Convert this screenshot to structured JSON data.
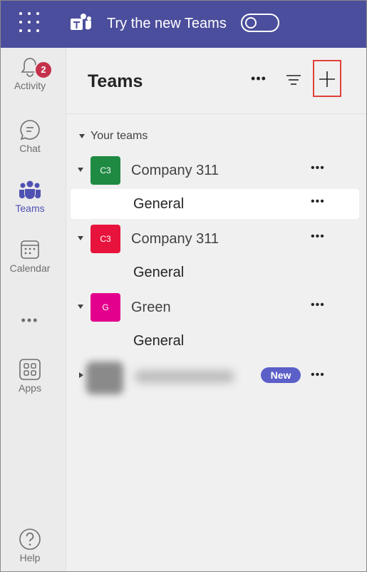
{
  "topbar": {
    "title": "Try the new Teams",
    "toggle_on": false,
    "bg_color": "#4b4e9c"
  },
  "rail": {
    "items": [
      {
        "label": "Activity",
        "icon": "bell-icon",
        "badge": "2"
      },
      {
        "label": "Chat",
        "icon": "chat-icon"
      },
      {
        "label": "Teams",
        "icon": "teams-icon",
        "active": true
      },
      {
        "label": "Calendar",
        "icon": "calendar-icon"
      },
      {
        "label": "Apps",
        "icon": "apps-icon"
      },
      {
        "label": "Help",
        "icon": "help-icon"
      }
    ],
    "more_label": "•••",
    "accent_color": "#4f52b2"
  },
  "panel": {
    "title": "Teams",
    "more_label": "•••",
    "section_label": "Your teams",
    "teams": [
      {
        "avatar": "C3",
        "name": "Company 311",
        "color": "#1f8a42",
        "channel": "General",
        "channel_selected": true
      },
      {
        "avatar": "C3",
        "name": "Company 311",
        "color": "#e8133c",
        "channel": "General",
        "channel_selected": false
      },
      {
        "avatar": "G",
        "name": "Green",
        "color": "#e3008c",
        "channel": "General",
        "channel_selected": false
      }
    ],
    "new_badge": "New",
    "row_more_label": "•••"
  }
}
